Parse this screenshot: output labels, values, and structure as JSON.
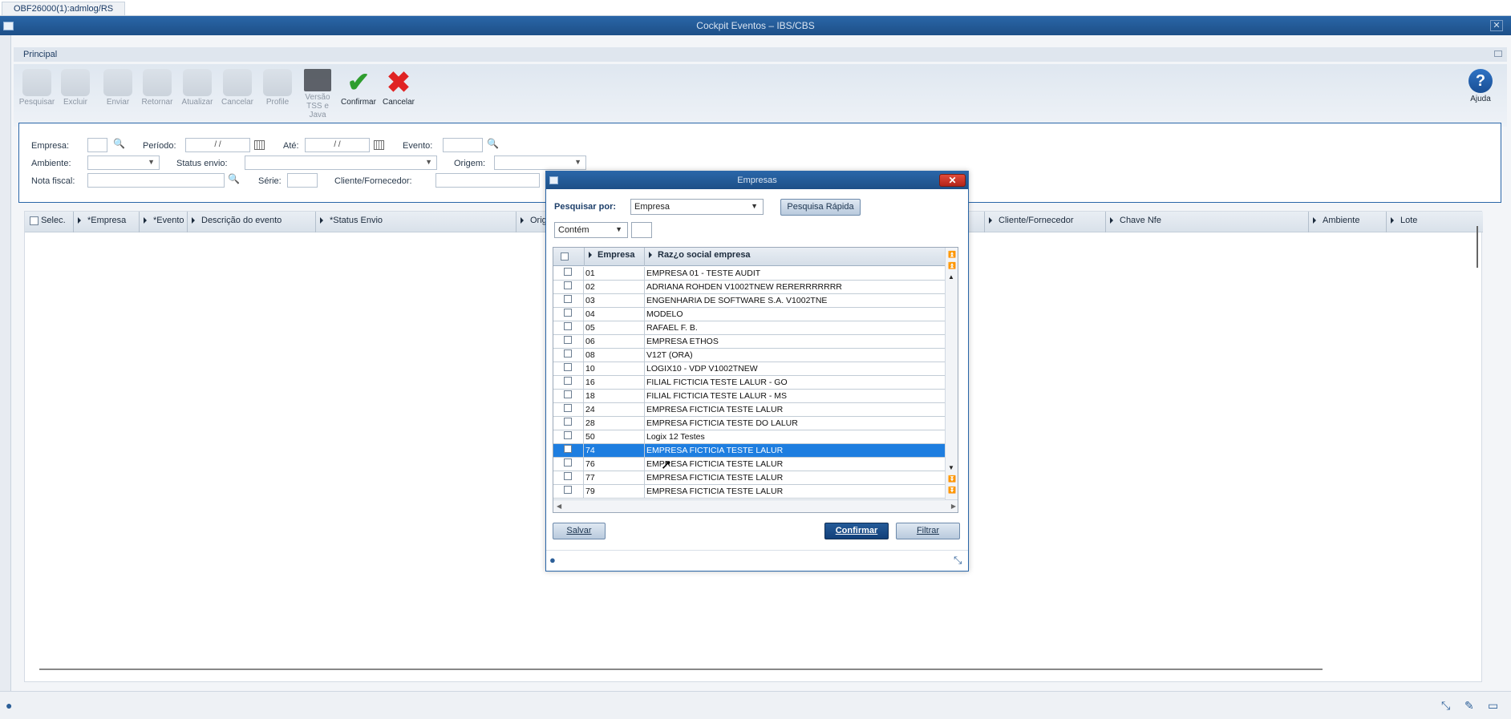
{
  "top_tab": "OBF26000(1):admlog/RS",
  "window_title": "Cockpit Eventos – IBS/CBS",
  "section": "Principal",
  "toolbar": {
    "pesquisar": "Pesquisar",
    "excluir": "Excluir",
    "enviar": "Enviar",
    "retornar": "Retornar",
    "atualizar": "Atualizar",
    "cancelar1": "Cancelar",
    "profile": "Profile",
    "versao_l1": "Versão",
    "versao_l2": "TSS e Java",
    "confirmar": "Confirmar",
    "cancelar2": "Cancelar",
    "ajuda": "Ajuda",
    "ajuda_glyph": "?"
  },
  "filters": {
    "empresa": "Empresa:",
    "periodo": "Período:",
    "periodo_value": "/ /",
    "ate": "Até:",
    "ate_value": "/ /",
    "evento": "Evento:",
    "ambiente": "Ambiente:",
    "status_envio": "Status envio:",
    "origem": "Origem:",
    "nota_fiscal": "Nota fiscal:",
    "serie": "Série:",
    "cliente_fornecedor": "Cliente/Fornecedor:"
  },
  "grid": {
    "columns": [
      "Selec.",
      "*Empresa",
      "*Evento",
      "Descrição do evento",
      "*Status Envio",
      "Orig",
      "Cliente/Fornecedor",
      "Chave Nfe",
      "Ambiente",
      "Lote"
    ]
  },
  "modal": {
    "title": "Empresas",
    "close": "✕",
    "pesquisar_por_label": "Pesquisar por:",
    "pesquisar_por_value": "Empresa",
    "pesquisa_rapida": "Pesquisa Rápida",
    "condicao_value": "Contém",
    "col_empresa": "Empresa",
    "col_razao": "Raz¿o social empresa",
    "rows": [
      {
        "code": "01",
        "name": "EMPRESA 01 - TESTE AUDIT"
      },
      {
        "code": "02",
        "name": "ADRIANA ROHDEN V1002TNEW RERERRRRRRR"
      },
      {
        "code": "03",
        "name": "ENGENHARIA DE SOFTWARE S.A. V1002TNE"
      },
      {
        "code": "04",
        "name": "MODELO"
      },
      {
        "code": "05",
        "name": "RAFAEL F. B."
      },
      {
        "code": "06",
        "name": "EMPRESA ETHOS"
      },
      {
        "code": "08",
        "name": "V12T (ORA)"
      },
      {
        "code": "10",
        "name": "LOGIX10 - VDP V1002TNEW"
      },
      {
        "code": "16",
        "name": "FILIAL FICTICIA TESTE LALUR - GO"
      },
      {
        "code": "18",
        "name": "FILIAL FICTICIA TESTE LALUR - MS"
      },
      {
        "code": "24",
        "name": "EMPRESA FICTICIA TESTE LALUR"
      },
      {
        "code": "28",
        "name": "EMPRESA FICTICIA TESTE DO LALUR"
      },
      {
        "code": "50",
        "name": "Logix 12 Testes"
      },
      {
        "code": "74",
        "name": "EMPRESA FICTICIA TESTE LALUR",
        "selected": true
      },
      {
        "code": "76",
        "name": "EMPRESA FICTICIA TESTE LALUR"
      },
      {
        "code": "77",
        "name": "EMPRESA FICTICIA TESTE LALUR"
      },
      {
        "code": "79",
        "name": "EMPRESA FICTICIA TESTE LALUR"
      }
    ],
    "salvar": "Salvar",
    "confirmar": "Confirmar",
    "filtrar": "Filtrar"
  },
  "colors": {
    "title_bar": "#1d4f87",
    "selected_row": "#1e7ee0",
    "primary_button": "#12407a"
  }
}
